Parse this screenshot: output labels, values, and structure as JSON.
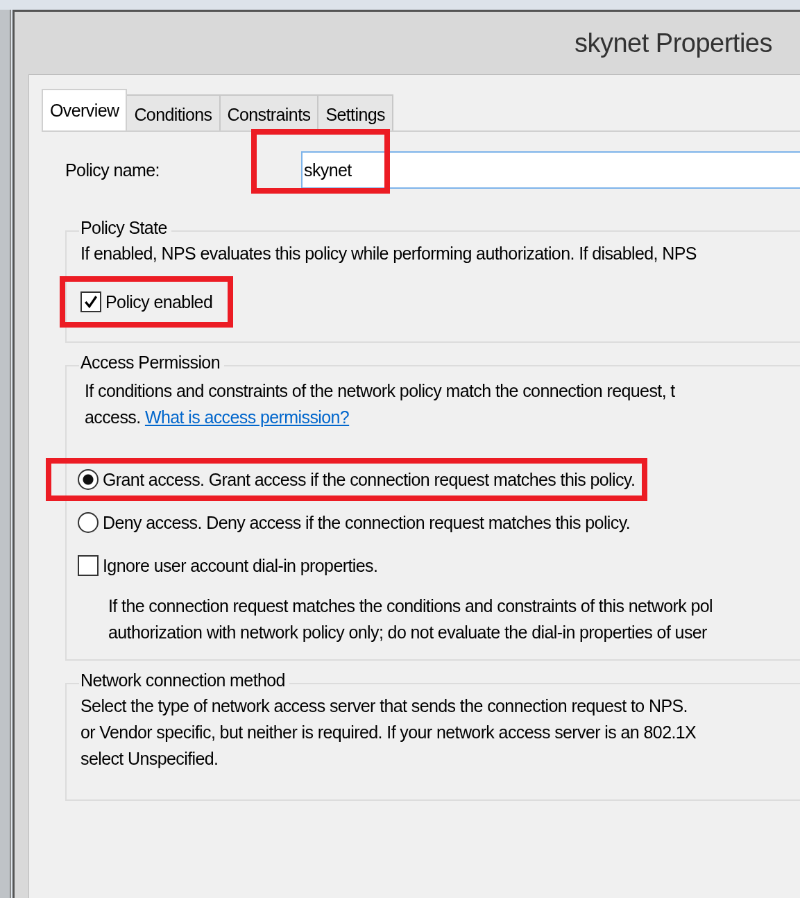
{
  "window": {
    "title": "skynet Properties"
  },
  "tabs": [
    {
      "label": "Overview",
      "selected": true
    },
    {
      "label": "Conditions",
      "selected": false
    },
    {
      "label": "Constraints",
      "selected": false
    },
    {
      "label": "Settings",
      "selected": false
    }
  ],
  "policy_name": {
    "label": "Policy name:",
    "value": "skynet",
    "highlighted": true
  },
  "policy_state": {
    "title": "Policy State",
    "description": [
      "If enabled, NPS evaluates this policy while performing authorization. If disabled, NPS"
    ],
    "checkbox": {
      "label": "Policy enabled",
      "checked": true,
      "highlighted": true
    }
  },
  "access_permission": {
    "title": "Access Permission",
    "description": [
      "If conditions and constraints of the network policy match the connection request, t",
      "access."
    ],
    "link": "What is access permission?",
    "options": [
      {
        "kind": "radio",
        "label": "Grant access. Grant access if the connection request matches this policy.",
        "selected": true,
        "highlighted": true
      },
      {
        "kind": "radio",
        "label": "Deny access. Deny access if the connection request matches this policy.",
        "selected": false,
        "highlighted": false
      },
      {
        "kind": "checkbox",
        "label": "Ignore user account dial-in properties.",
        "checked": false,
        "highlighted": false,
        "description": [
          "If the connection request matches the conditions and constraints of this network pol",
          "authorization with network policy only; do not evaluate the dial-in properties of user"
        ]
      }
    ]
  },
  "network_connection_method": {
    "title": "Network connection method",
    "description": [
      "Select the type of network access server that sends the connection request to NPS.",
      "or Vendor specific, but neither is required.  If your network access server is an 802.1X",
      "select Unspecified."
    ]
  }
}
